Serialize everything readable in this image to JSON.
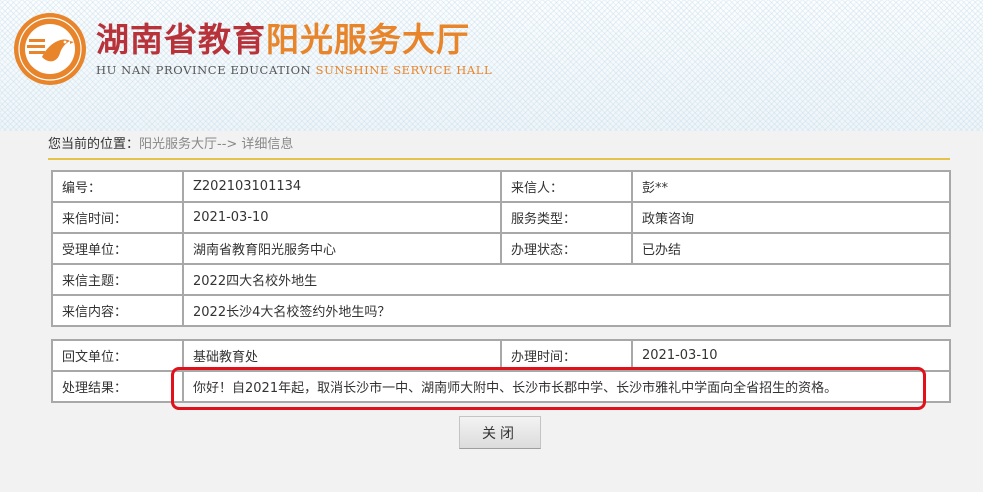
{
  "header": {
    "title_part1": "湖南省教育",
    "title_part2": "阳光服务大厅",
    "subtitle_part1": "HU NAN PROVINCE EDUCATION",
    "subtitle_part2": "SUNSHINE SERVICE HALL",
    "logo_icon": "bird-sun-logo-icon"
  },
  "breadcrumb": {
    "label": "您当前的位置：",
    "path": "阳光服务大厅--> 详细信息"
  },
  "details": {
    "id_label": "编号：",
    "id_value": "Z202103101134",
    "sender_label": "来信人：",
    "sender_value": "彭**",
    "date_label": "来信时间：",
    "date_value": "2021-03-10",
    "service_type_label": "服务类型：",
    "service_type_value": "政策咨询",
    "unit_label": "受理单位：",
    "unit_value": "湖南省教育阳光服务中心",
    "status_label": "办理状态：",
    "status_value": "已办结",
    "subject_label": "来信主题：",
    "subject_value": "2022四大名校外地生",
    "content_label": "来信内容：",
    "content_value": "2022长沙4大名校签约外地生吗？"
  },
  "reply": {
    "reply_unit_label": "回文单位：",
    "reply_unit_value": "基础教育处",
    "handle_time_label": "办理时间：",
    "handle_time_value": "2021-03-10",
    "result_label": "处理结果：",
    "result_value": "你好！自2021年起，取消长沙市一中、湖南师大附中、长沙市长郡中学、长沙市雅礼中学面向全省招生的资格。"
  },
  "actions": {
    "close_label": "关闭"
  },
  "colors": {
    "title_red": "#b8323a",
    "title_orange": "#e8842a",
    "highlight_red": "#e0111b",
    "divider_gold": "#e7c24a"
  }
}
